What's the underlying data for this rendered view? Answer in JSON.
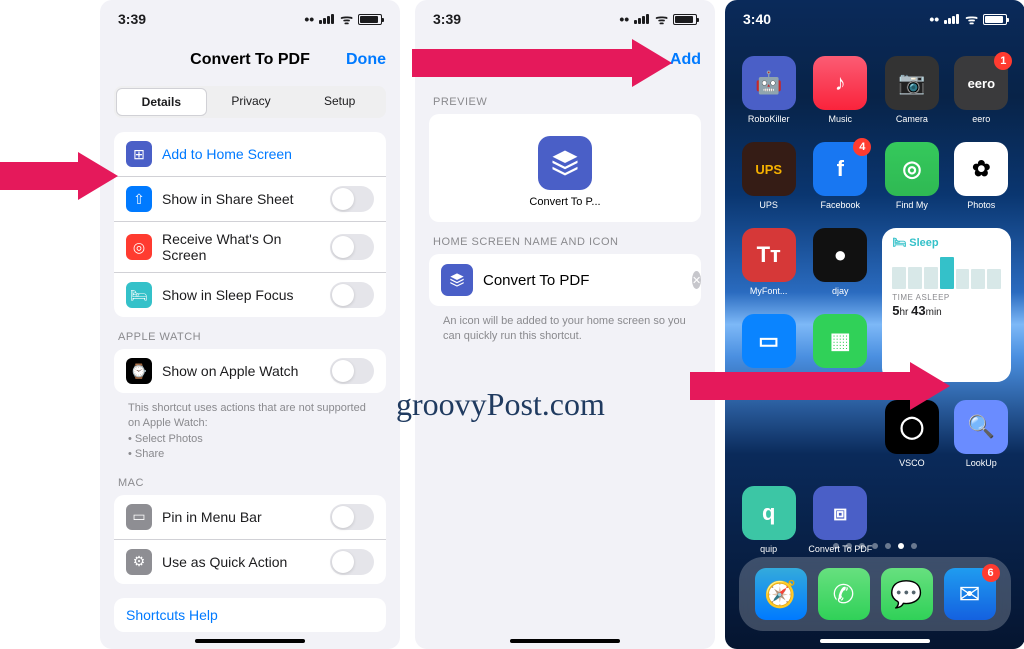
{
  "status": {
    "time1": "3:39",
    "time2": "3:39",
    "time3": "3:40",
    "loc": "◀"
  },
  "panel1": {
    "title": "Convert To PDF",
    "done": "Done",
    "tabs": [
      "Details",
      "Privacy",
      "Setup"
    ],
    "rows": {
      "add_home": "Add to Home Screen",
      "share_sheet": "Show in Share Sheet",
      "on_screen": "Receive What's On Screen",
      "sleep_focus": "Show in Sleep Focus",
      "apple_watch_header": "APPLE WATCH",
      "apple_watch": "Show on Apple Watch",
      "watch_note": "This shortcut uses actions that are not supported on Apple Watch:",
      "watch_note_items": [
        "• Select Photos",
        "• Share"
      ],
      "mac_header": "MAC",
      "pin_menu": "Pin in Menu Bar",
      "quick_action": "Use as Quick Action",
      "help": "Shortcuts Help"
    }
  },
  "panel2": {
    "add": "Add",
    "preview_header": "PREVIEW",
    "preview_label": "Convert To P...",
    "name_header": "HOME SCREEN NAME AND ICON",
    "name_value": "Convert To PDF",
    "name_note": "An icon will be added to your home screen so you can quickly run this shortcut."
  },
  "panel3": {
    "apps": [
      {
        "name": "RoboKiller",
        "bg": "#4a5fc7"
      },
      {
        "name": "Music",
        "bg": "linear-gradient(#fb5c74,#fa233b)"
      },
      {
        "name": "Camera",
        "bg": "#333"
      },
      {
        "name": "eero",
        "bg": "#3a3a3c",
        "badge": "1"
      },
      {
        "name": "UPS",
        "bg": "#351c15"
      },
      {
        "name": "Facebook",
        "bg": "#1877f2",
        "badge": "4"
      },
      {
        "name": "Find My",
        "bg": "linear-gradient(#35c95c,#2fb953)"
      },
      {
        "name": "Photos",
        "bg": "#fff"
      },
      {
        "name": "MyFont...",
        "bg": "#d63838"
      },
      {
        "name": "djay",
        "bg": "#111"
      },
      {
        "name": "Keynote",
        "bg": "#0a84ff"
      },
      {
        "name": "Numbers",
        "bg": "#30d158"
      },
      {
        "name": "VSCO",
        "bg": "#000"
      },
      {
        "name": "LookUp",
        "bg": "#6a8cff"
      },
      {
        "name": "quip",
        "bg": "#3cc6a5"
      },
      {
        "name": "Convert To PDF",
        "bg": "#4a5fc7"
      }
    ],
    "widget": {
      "title": "🛏 Sleep",
      "sub": "TIME ASLEEP",
      "val_hr": "5",
      "hr": "hr",
      "val_min": "43",
      "min": "min",
      "label": "Sleep"
    },
    "dock": [
      {
        "name": "safari",
        "bg": "linear-gradient(#34aadc,#007aff)"
      },
      {
        "name": "phone",
        "bg": "linear-gradient(#67e07f,#30d158)"
      },
      {
        "name": "messages",
        "bg": "linear-gradient(#67e07f,#30d158)"
      },
      {
        "name": "mail",
        "bg": "linear-gradient(#1f9cf0,#1461e0)",
        "badge": "6"
      }
    ]
  },
  "watermark": "groovyPost.com"
}
